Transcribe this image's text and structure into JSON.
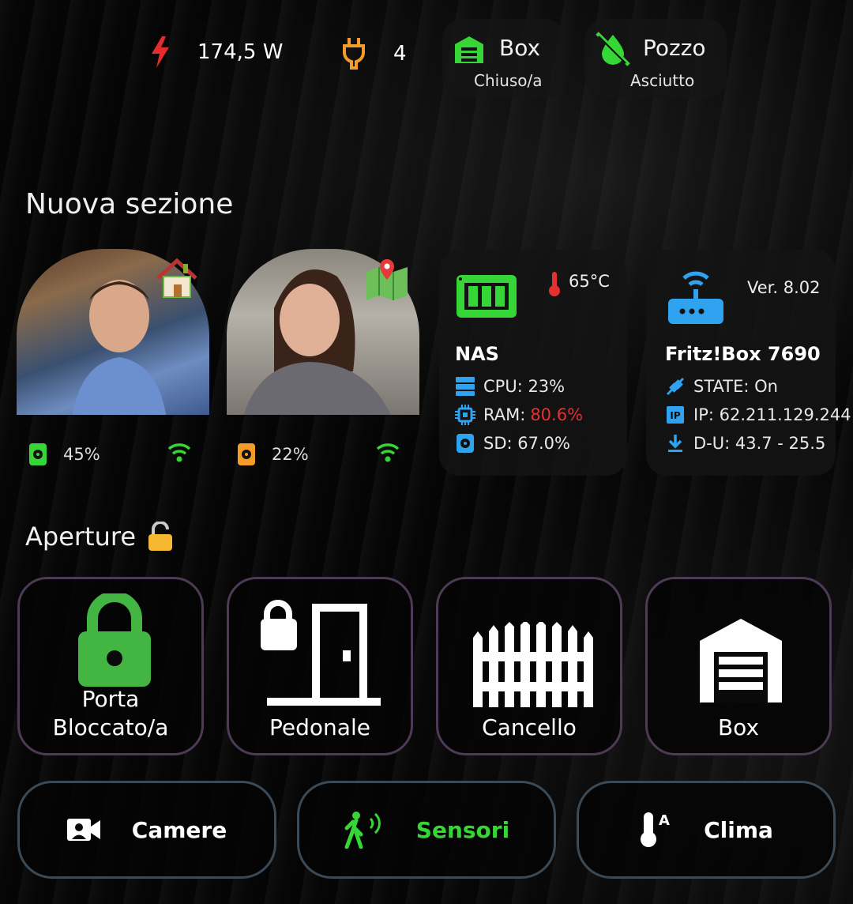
{
  "top": {
    "power": "174,5 W",
    "plugs": "4",
    "box": {
      "title": "Box",
      "state": "Chiuso/a"
    },
    "well": {
      "title": "Pozzo",
      "state": "Asciutto"
    }
  },
  "section_title": "Nuova sezione",
  "persons": [
    {
      "battery": "45%",
      "battery_color": "#35d635",
      "wifi_color": "#35d635"
    },
    {
      "battery": "22%",
      "battery_color": "#f39c2a",
      "wifi_color": "#35d635"
    }
  ],
  "nas": {
    "title": "NAS",
    "temp": "65°C",
    "cpu": "CPU: 23%",
    "ram_label": "RAM:",
    "ram_value": "80.6%",
    "sd": "SD: 67.0%"
  },
  "router": {
    "title": "Fritz!Box 7690",
    "version": "Ver. 8.02",
    "state": "STATE: On",
    "ip": "IP: 62.211.129.244",
    "du": "D-U: 43.7 - 25.5"
  },
  "openings_title": "Aperture",
  "openings": [
    {
      "label": "Porta",
      "sub": "Bloccato/a",
      "icon": "lock-icon"
    },
    {
      "label": "Pedonale",
      "sub": "",
      "icon": "door-lock-icon"
    },
    {
      "label": "Cancello",
      "sub": "",
      "icon": "gate-icon"
    },
    {
      "label": "Box",
      "sub": "",
      "icon": "garage-icon"
    }
  ],
  "nav": [
    {
      "label": "Camere",
      "icon": "camera-icon"
    },
    {
      "label": "Sensori",
      "icon": "motion-sensor-icon"
    },
    {
      "label": "Clima",
      "icon": "thermometer-icon"
    }
  ],
  "colors": {
    "accent_green": "#35d635",
    "router_blue": "#2fa3f0",
    "alert_red": "#e53030",
    "orange": "#f39c2a"
  }
}
